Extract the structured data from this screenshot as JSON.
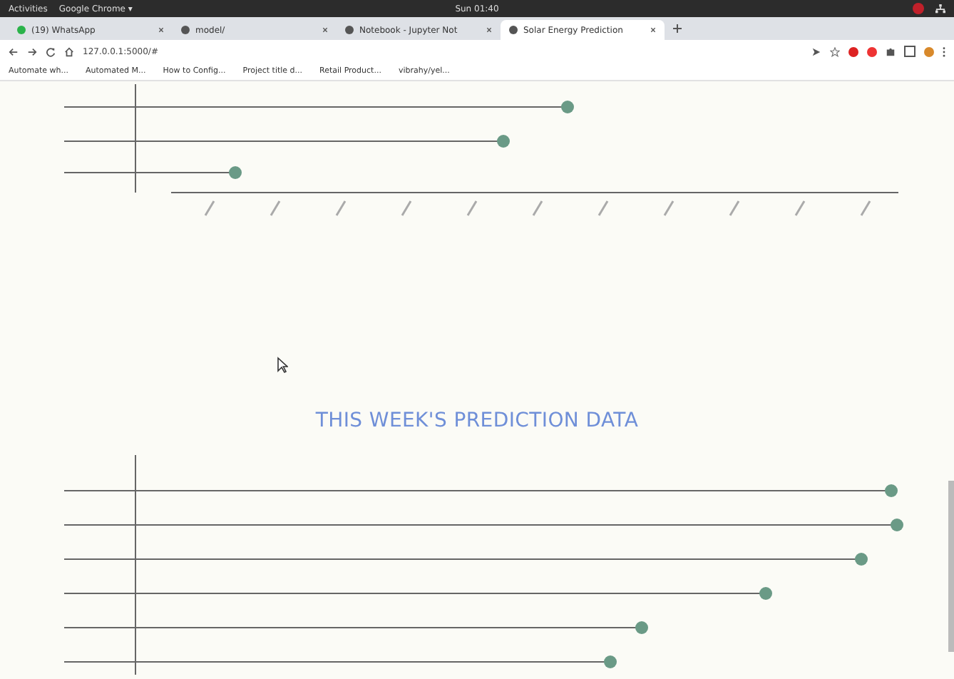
{
  "topbar": {
    "activities": "Activities",
    "app": "Google Chrome ▾",
    "clock": "Sun 01:40"
  },
  "tabs": [
    {
      "label": "(19) WhatsApp",
      "selected": false
    },
    {
      "label": "model/",
      "selected": false
    },
    {
      "label": "Notebook - Jupyter Not",
      "selected": false
    },
    {
      "label": "Solar Energy Prediction",
      "selected": true
    }
  ],
  "address": "127.0.0.1:5000/#",
  "bookmarks": [
    "Automate wh...",
    "Automated M...",
    "How to Config...",
    "Project title d...",
    "Retail Product...",
    "vibrahy/yel..."
  ],
  "heading": "THIS WEEK'S PREDICTION DATA"
}
